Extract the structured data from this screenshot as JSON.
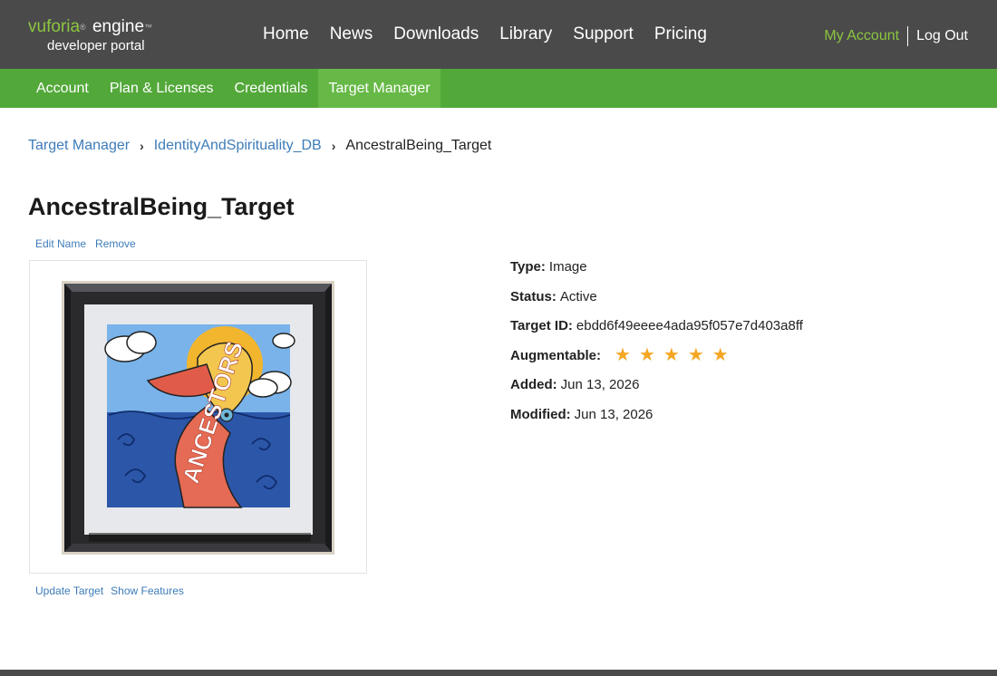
{
  "logo": {
    "brand": "vuforia",
    "tm": "®",
    "engine": "engine",
    "tm2": "™",
    "subtitle": "developer portal"
  },
  "main_nav": [
    "Home",
    "News",
    "Downloads",
    "Library",
    "Support",
    "Pricing"
  ],
  "account": {
    "my_account": "My Account",
    "log_out": "Log Out"
  },
  "sub_nav": {
    "items": [
      "Account",
      "Plan & Licenses",
      "Credentials",
      "Target Manager"
    ],
    "active": "Target Manager"
  },
  "breadcrumb": {
    "items": [
      "Target Manager",
      "IdentityAndSpirituality_DB"
    ],
    "separator": "›",
    "current": "AncestralBeing_Target"
  },
  "target": {
    "title": "AncestralBeing_Target",
    "actions": [
      "Edit Name",
      "Remove"
    ],
    "bottom_actions": [
      "Update Target",
      "Show Features"
    ],
    "image_text": "ANCESTORS"
  },
  "details": {
    "type_label": "Type:",
    "type_value": "Image",
    "status_label": "Status:",
    "status_value": "Active",
    "id_label": "Target ID:",
    "id_value": "ebdd6f49eeee4ada95f057e7d403a8ff",
    "augmentable_label": "Augmentable:",
    "augmentable_rating": 5,
    "augmentable_max": 5,
    "added_label": "Added:",
    "added_value": "Jun 13, 2026",
    "modified_label": "Modified:",
    "modified_value": "Jun 13, 2026"
  },
  "colors": {
    "header_bg": "#4a4a4b",
    "subnav_bg": "#53a83a",
    "subnav_active": "#66b946",
    "brand_green": "#8cc63f",
    "link_blue": "#3d7cb8",
    "star": "#f5a623"
  },
  "icons": [
    "breadcrumb-chevron-icon",
    "star-icon"
  ]
}
